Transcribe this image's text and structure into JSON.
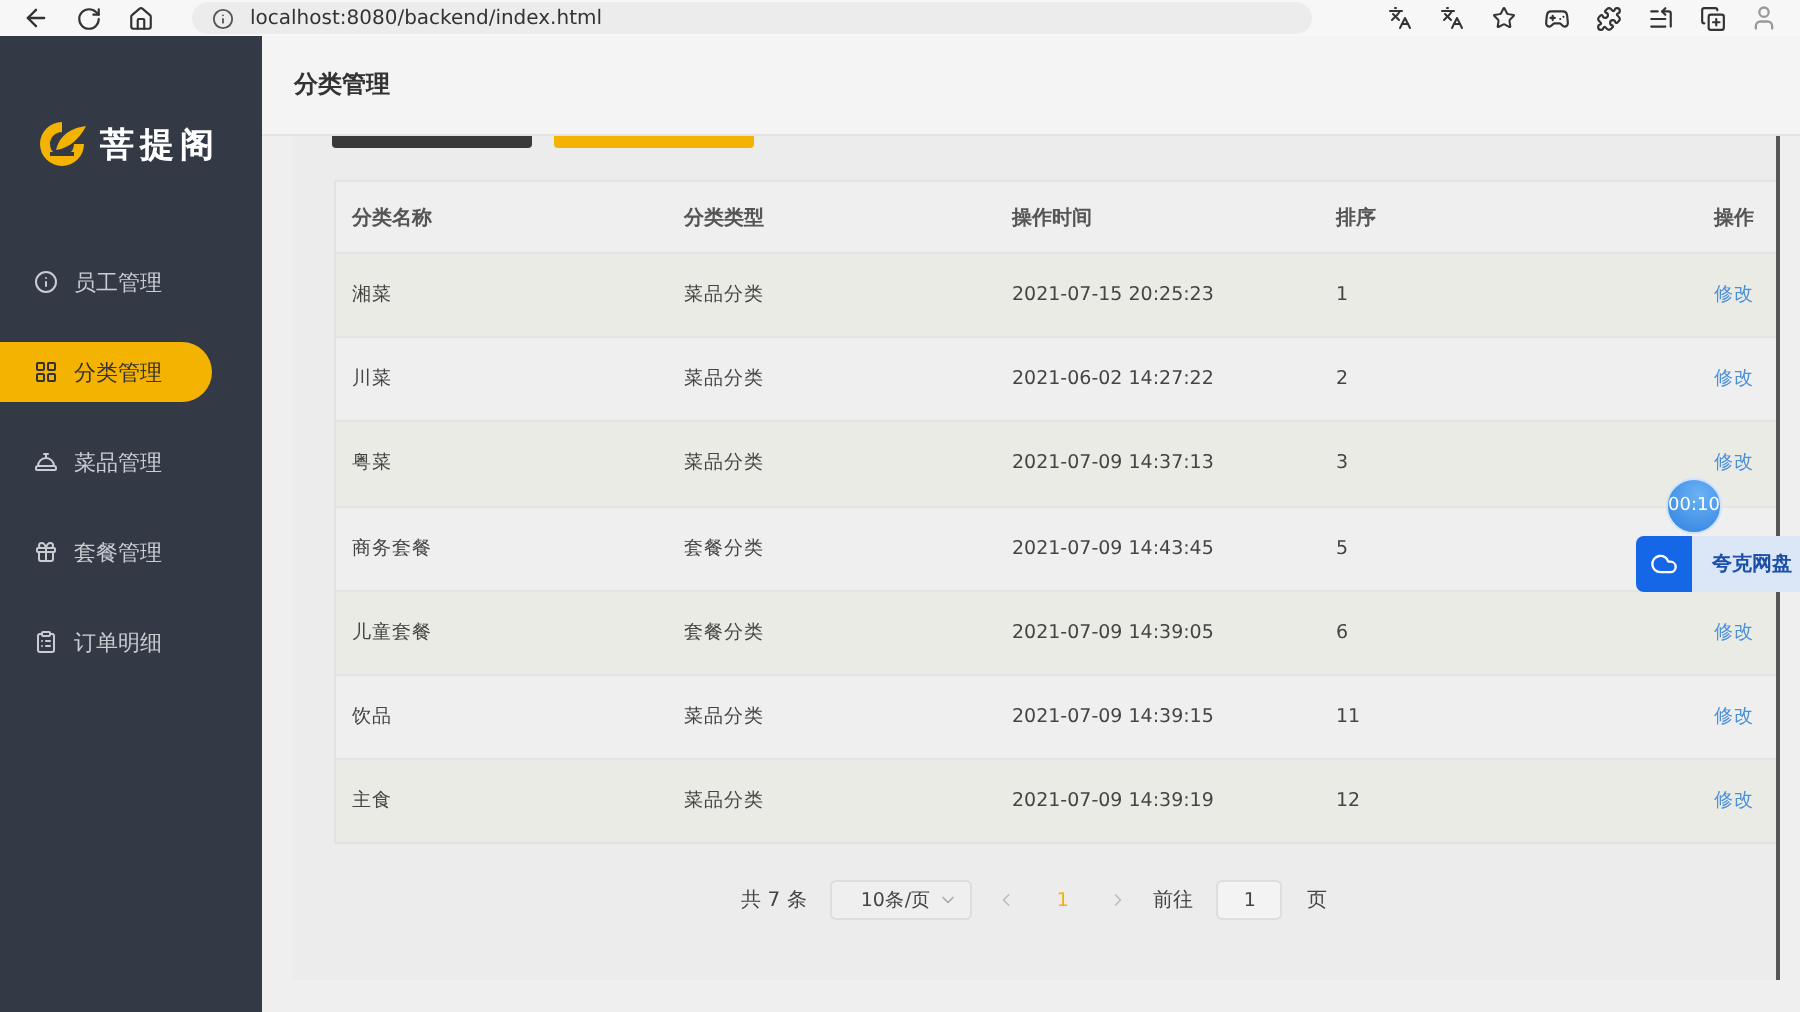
{
  "browser": {
    "url": "localhost:8080/backend/index.html"
  },
  "brand": {
    "name": "菩提阁"
  },
  "sidebar": {
    "items": [
      {
        "label": "员工管理",
        "selected": false
      },
      {
        "label": "分类管理",
        "selected": true
      },
      {
        "label": "菜品管理",
        "selected": false
      },
      {
        "label": "套餐管理",
        "selected": false
      },
      {
        "label": "订单明细",
        "selected": false
      }
    ]
  },
  "header": {
    "title": "分类管理"
  },
  "table": {
    "columns": [
      "分类名称",
      "分类类型",
      "操作时间",
      "排序",
      "操作"
    ],
    "rows": [
      {
        "cells": [
          "湘菜",
          "菜品分类",
          "2021-07-15 20:25:23",
          "1"
        ],
        "action": "修改"
      },
      {
        "cells": [
          "川菜",
          "菜品分类",
          "2021-06-02 14:27:22",
          "2"
        ],
        "action": "修改"
      },
      {
        "cells": [
          "粤菜",
          "菜品分类",
          "2021-07-09 14:37:13",
          "3"
        ],
        "action": "修改"
      },
      {
        "cells": [
          "商务套餐",
          "套餐分类",
          "2021-07-09 14:43:45",
          "5"
        ]
      },
      {
        "cells": [
          "儿童套餐",
          "套餐分类",
          "2021-07-09 14:39:05",
          "6"
        ],
        "action": "修改"
      },
      {
        "cells": [
          "饮品",
          "菜品分类",
          "2021-07-09 14:39:15",
          "11"
        ],
        "action": "修改"
      },
      {
        "cells": [
          "主食",
          "菜品分类",
          "2021-07-09 14:39:19",
          "12"
        ],
        "action": "修改"
      }
    ]
  },
  "pagination": {
    "total": "共 7 条",
    "page_size": "10条/页",
    "pages": [
      {
        "label": "1",
        "selected": true
      }
    ],
    "goto_label": "前往",
    "goto_value": "1",
    "page_unit": "页"
  },
  "overlays": {
    "timer": "00:10",
    "cloud_drive": "夸克网盘"
  }
}
